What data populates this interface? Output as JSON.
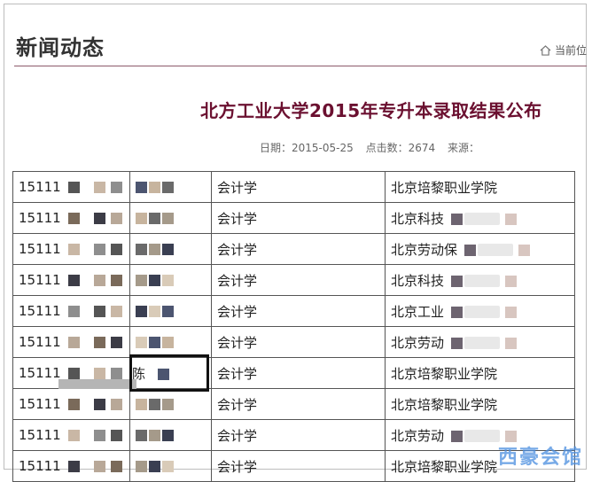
{
  "section_title": "新闻动态",
  "breadcrumb": {
    "label": "当前位"
  },
  "article": {
    "title": "北方工业大学2015年专升本录取结果公布",
    "date_label": "日期：",
    "date": "2015-05-25",
    "clicks_label": "点击数：",
    "clicks": "2674",
    "source_label": "来源："
  },
  "table": {
    "rows": [
      {
        "id": "15111",
        "name": "",
        "major": "会计学",
        "school": "北京培黎职业学院"
      },
      {
        "id": "15111",
        "name": "",
        "major": "会计学",
        "school": "北京科技"
      },
      {
        "id": "15111",
        "name": "",
        "major": "会计学",
        "school": "北京劳动保"
      },
      {
        "id": "15111",
        "name": "",
        "major": "会计学",
        "school": "北京科技"
      },
      {
        "id": "15111",
        "name": "",
        "major": "会计学",
        "school": "北京工业"
      },
      {
        "id": "15111",
        "name": "",
        "major": "会计学",
        "school": "北京劳动"
      },
      {
        "id": "15111",
        "name": "陈",
        "major": "会计学",
        "school": "北京培黎职业学院"
      },
      {
        "id": "15111",
        "name": "",
        "major": "会计学",
        "school": "北京培黎职业学院"
      },
      {
        "id": "15111",
        "name": "",
        "major": "会计学",
        "school": "北京劳动"
      },
      {
        "id": "15111",
        "name": "",
        "major": "会计学",
        "school": "北京培黎职业学院"
      }
    ]
  },
  "watermark": "西豪会馆",
  "colors": {
    "title": "#6b1030",
    "divider": "#8c5a6a",
    "highlight_box": "#111111"
  }
}
